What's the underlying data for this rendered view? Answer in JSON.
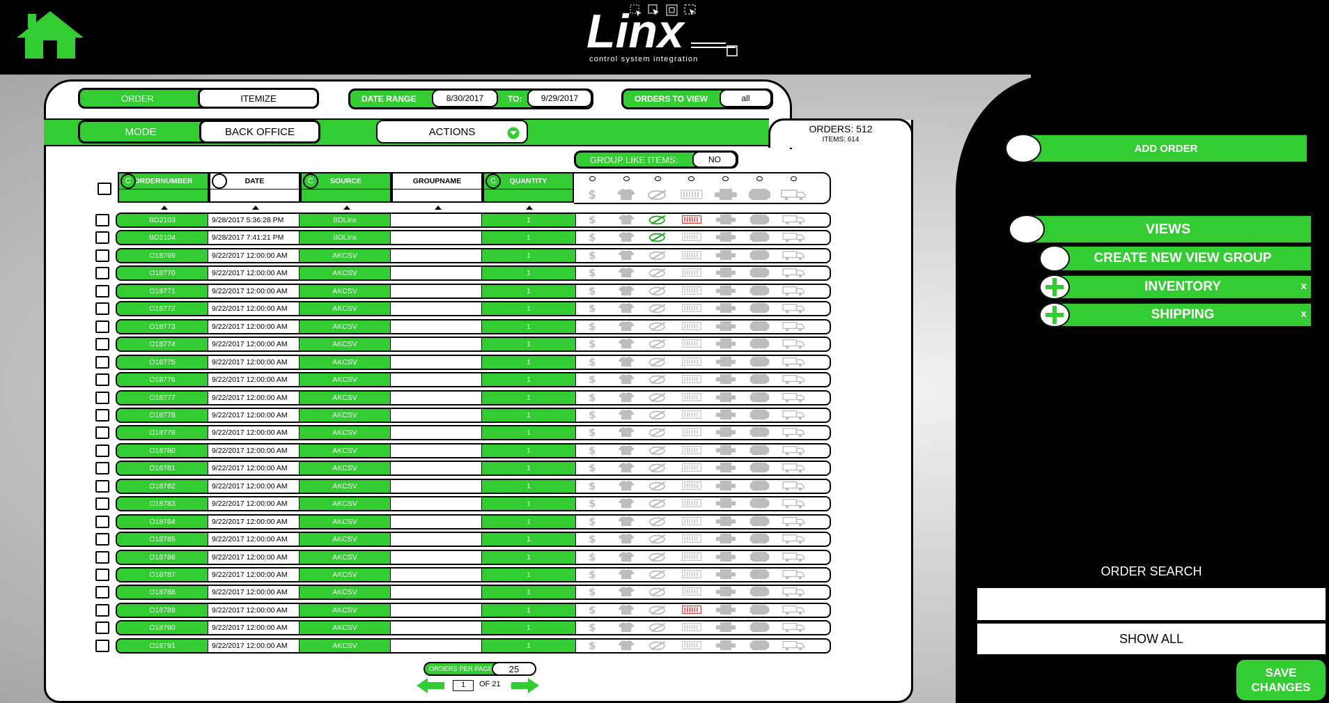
{
  "header": {
    "home_icon": "home-icon",
    "logo_text": "Linx",
    "logo_tagline": "control system integration",
    "window_tools": [
      "select-region-icon",
      "pointer-icon",
      "frame-icon",
      "capture-icon"
    ]
  },
  "toolbar": {
    "order_label": "ORDER",
    "itemize_label": "ITEMIZE",
    "date_range_label": "DATE RANGE",
    "date_from": "8/30/2017",
    "to_label": "TO:",
    "date_to": "9/29/2017",
    "orders_to_view_label": "ORDERS TO VIEW",
    "orders_to_view_value": "all",
    "mode_label": "MODE",
    "mode_value": "BACK OFFICE",
    "actions_label": "ACTIONS",
    "orders_count": "ORDERS: 512",
    "items_count": "ITEMS: 614",
    "group_like_items_label": "GROUP LIKE ITEMS:",
    "group_like_items_value": "NO"
  },
  "table": {
    "clear_label": "C",
    "columns": [
      "ORDERNUMBER",
      "DATE",
      "SOURCE",
      "GROUPNAME",
      "QUANTITY"
    ],
    "status_icons": [
      "dollar-icon",
      "shirt-icon",
      "paint-palette-icon",
      "barcode-icon",
      "printer-icon",
      "badge-icon",
      "truck-icon"
    ],
    "rows": [
      {
        "order": "BD2103",
        "date": "9/28/2017 5:36:28 PM",
        "source": "BDLinx",
        "group": "",
        "qty": "1",
        "paint_active": true,
        "barcode_active": true
      },
      {
        "order": "BD2104",
        "date": "9/28/2017 7:41:21 PM",
        "source": "BDLinx",
        "group": "",
        "qty": "1",
        "paint_active": true,
        "barcode_active": false
      },
      {
        "order": "O18769",
        "date": "9/22/2017 12:00:00 AM",
        "source": "AKCSV",
        "group": "",
        "qty": "1",
        "paint_active": false,
        "barcode_active": false
      },
      {
        "order": "O18770",
        "date": "9/22/2017 12:00:00 AM",
        "source": "AKCSV",
        "group": "",
        "qty": "1",
        "paint_active": false,
        "barcode_active": false
      },
      {
        "order": "O18771",
        "date": "9/22/2017 12:00:00 AM",
        "source": "AKCSV",
        "group": "",
        "qty": "1",
        "paint_active": false,
        "barcode_active": false
      },
      {
        "order": "O18772",
        "date": "9/22/2017 12:00:00 AM",
        "source": "AKCSV",
        "group": "",
        "qty": "1",
        "paint_active": false,
        "barcode_active": false
      },
      {
        "order": "O18773",
        "date": "9/22/2017 12:00:00 AM",
        "source": "AKCSV",
        "group": "",
        "qty": "1",
        "paint_active": false,
        "barcode_active": false
      },
      {
        "order": "O18774",
        "date": "9/22/2017 12:00:00 AM",
        "source": "AKCSV",
        "group": "",
        "qty": "1",
        "paint_active": false,
        "barcode_active": false
      },
      {
        "order": "O18775",
        "date": "9/22/2017 12:00:00 AM",
        "source": "AKCSV",
        "group": "",
        "qty": "1",
        "paint_active": false,
        "barcode_active": false
      },
      {
        "order": "O18776",
        "date": "9/22/2017 12:00:00 AM",
        "source": "AKCSV",
        "group": "",
        "qty": "1",
        "paint_active": false,
        "barcode_active": false
      },
      {
        "order": "O18777",
        "date": "9/22/2017 12:00:00 AM",
        "source": "AKCSV",
        "group": "",
        "qty": "1",
        "paint_active": false,
        "barcode_active": false
      },
      {
        "order": "O18778",
        "date": "9/22/2017 12:00:00 AM",
        "source": "AKCSV",
        "group": "",
        "qty": "1",
        "paint_active": false,
        "barcode_active": false
      },
      {
        "order": "O18779",
        "date": "9/22/2017 12:00:00 AM",
        "source": "AKCSV",
        "group": "",
        "qty": "1",
        "paint_active": false,
        "barcode_active": false
      },
      {
        "order": "O18780",
        "date": "9/22/2017 12:00:00 AM",
        "source": "AKCSV",
        "group": "",
        "qty": "1",
        "paint_active": false,
        "barcode_active": false
      },
      {
        "order": "O18781",
        "date": "9/22/2017 12:00:00 AM",
        "source": "AKCSV",
        "group": "",
        "qty": "1",
        "paint_active": false,
        "barcode_active": false
      },
      {
        "order": "O18782",
        "date": "9/22/2017 12:00:00 AM",
        "source": "AKCSV",
        "group": "",
        "qty": "1",
        "paint_active": false,
        "barcode_active": false
      },
      {
        "order": "O18783",
        "date": "9/22/2017 12:00:00 AM",
        "source": "AKCSV",
        "group": "",
        "qty": "1",
        "paint_active": false,
        "barcode_active": false
      },
      {
        "order": "O18784",
        "date": "9/22/2017 12:00:00 AM",
        "source": "AKCSV",
        "group": "",
        "qty": "1",
        "paint_active": false,
        "barcode_active": false
      },
      {
        "order": "O18785",
        "date": "9/22/2017 12:00:00 AM",
        "source": "AKCSV",
        "group": "",
        "qty": "1",
        "paint_active": false,
        "barcode_active": false
      },
      {
        "order": "O18786",
        "date": "9/22/2017 12:00:00 AM",
        "source": "AKCSV",
        "group": "",
        "qty": "1",
        "paint_active": false,
        "barcode_active": false
      },
      {
        "order": "O18787",
        "date": "9/22/2017 12:00:00 AM",
        "source": "AKCSV",
        "group": "",
        "qty": "1",
        "paint_active": false,
        "barcode_active": false
      },
      {
        "order": "O18788",
        "date": "9/22/2017 12:00:00 AM",
        "source": "AKCSV",
        "group": "",
        "qty": "1",
        "paint_active": false,
        "barcode_active": false
      },
      {
        "order": "O18789",
        "date": "9/22/2017 12:00:00 AM",
        "source": "AKCSV",
        "group": "",
        "qty": "1",
        "paint_active": false,
        "barcode_active": true
      },
      {
        "order": "O18790",
        "date": "9/22/2017 12:00:00 AM",
        "source": "AKCSV",
        "group": "",
        "qty": "1",
        "paint_active": false,
        "barcode_active": false
      },
      {
        "order": "O18791",
        "date": "9/22/2017 12:00:00 AM",
        "source": "AKCSV",
        "group": "",
        "qty": "1",
        "paint_active": false,
        "barcode_active": false
      }
    ]
  },
  "pagination": {
    "orders_per_page_label": "ORDERS PER PAGE:",
    "orders_per_page_value": "25",
    "current_page": "1",
    "of_label": "OF 21"
  },
  "sidebar": {
    "add_order_label": "ADD ORDER",
    "views_label": "VIEWS",
    "create_view_group_label": "CREATE NEW VIEW GROUP",
    "view_groups": [
      {
        "label": "INVENTORY",
        "close": "x"
      },
      {
        "label": "SHIPPING",
        "close": "x"
      }
    ],
    "order_search_label": "ORDER SEARCH",
    "order_search_value": "",
    "show_all_label": "SHOW ALL",
    "save_changes_label": "SAVE CHANGES"
  },
  "colors": {
    "accent_green": "#33cc33",
    "active_paint": "#22aa22",
    "active_barcode": "#dd2222",
    "inactive_icon": "#bdbdbd"
  }
}
